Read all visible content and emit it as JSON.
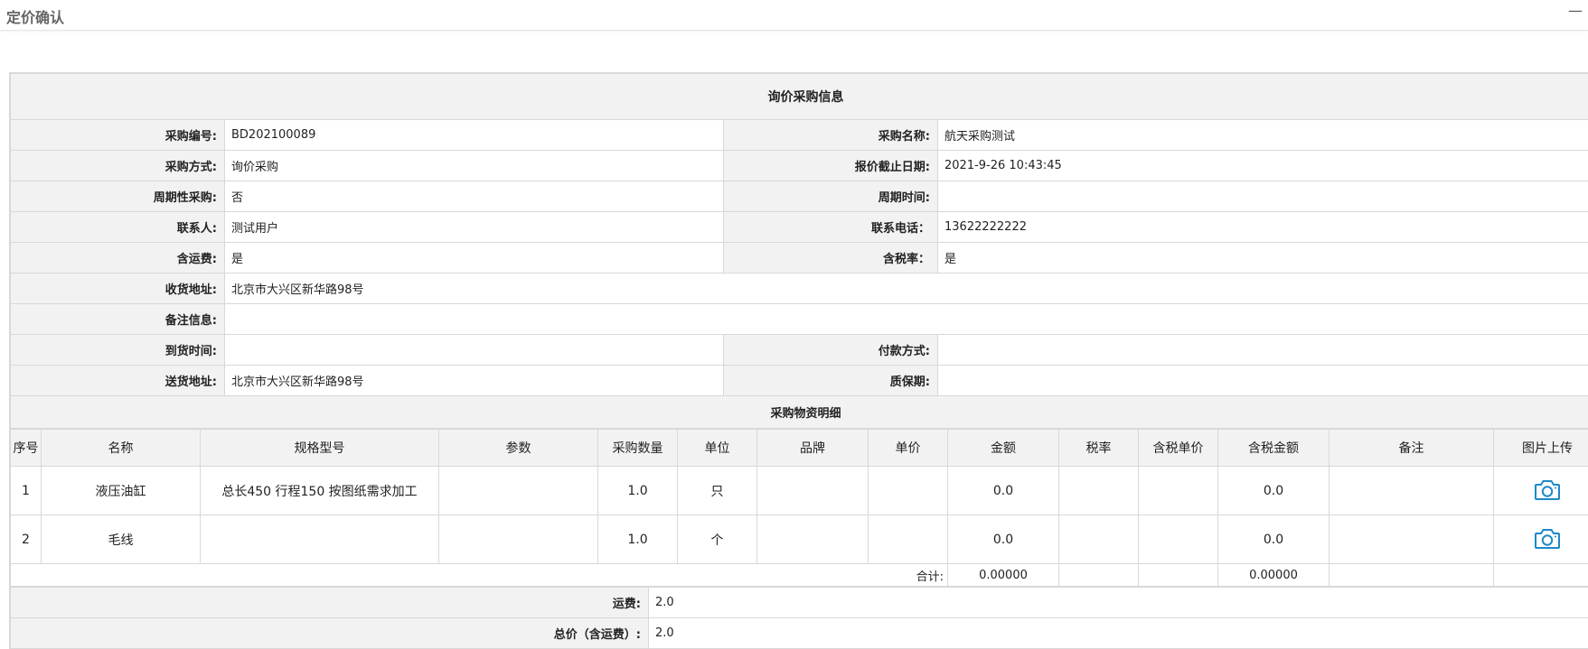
{
  "header": {
    "title": "定价确认",
    "minimize_label": "—"
  },
  "inquiry": {
    "section_title": "询价采购信息",
    "fields": {
      "purchase_no_label": "采购编号:",
      "purchase_no": "BD202100089",
      "purchase_name_label": "采购名称:",
      "purchase_name": "航天采购测试",
      "purchase_method_label": "采购方式:",
      "purchase_method": "询价采购",
      "quote_deadline_label": "报价截止日期:",
      "quote_deadline": "2021-9-26 10:43:45",
      "periodic_label": "周期性采购:",
      "periodic": "否",
      "cycle_time_label": "周期时间:",
      "cycle_time": "",
      "contact_label": "联系人:",
      "contact": "测试用户",
      "phone_label": "联系电话：",
      "phone": "13622222222",
      "freight_included_label": "含运费:",
      "freight_included": "是",
      "tax_included_label": "含税率：",
      "tax_included": "是",
      "receive_address_label": "收货地址:",
      "receive_address": "北京市大兴区新华路98号",
      "remark_label": "备注信息:",
      "remark": "",
      "arrival_time_label": "到货时间:",
      "arrival_time": "",
      "payment_label": "付款方式:",
      "payment": "",
      "delivery_address_label": "送货地址:",
      "delivery_address": "北京市大兴区新华路98号",
      "warranty_label": "质保期:",
      "warranty": ""
    }
  },
  "materials": {
    "section_title": "采购物资明细",
    "columns": [
      "序号",
      "名称",
      "规格型号",
      "参数",
      "采购数量",
      "单位",
      "品牌",
      "单价",
      "金额",
      "税率",
      "含税单价",
      "含税金额",
      "备注",
      "图片上传"
    ],
    "rows": [
      {
        "no": "1",
        "name": "液压油缸",
        "spec": "总长450 行程150 按图纸需求加工",
        "param": "",
        "qty": "1.0",
        "unit": "只",
        "brand": "",
        "price": "",
        "amount": "0.0",
        "tax": "",
        "tax_price": "",
        "tax_amount": "0.0",
        "remark": "",
        "upload_icon": "camera-icon"
      },
      {
        "no": "2",
        "name": "毛线",
        "spec": "",
        "param": "",
        "qty": "1.0",
        "unit": "个",
        "brand": "",
        "price": "",
        "amount": "0.0",
        "tax": "",
        "tax_price": "",
        "tax_amount": "0.0",
        "remark": "",
        "upload_icon": "camera-icon"
      }
    ],
    "total": {
      "label": "合计:",
      "amount": "0.00000",
      "tax_amount": "0.00000"
    }
  },
  "fees": {
    "freight_label": "运费:",
    "freight": "2.0",
    "total_label": "总价（含运费）:",
    "total": "2.0"
  },
  "colors": {
    "accent": "#1e88c8",
    "header_bg": "#f2f2f2",
    "border": "#d8d8d8"
  }
}
